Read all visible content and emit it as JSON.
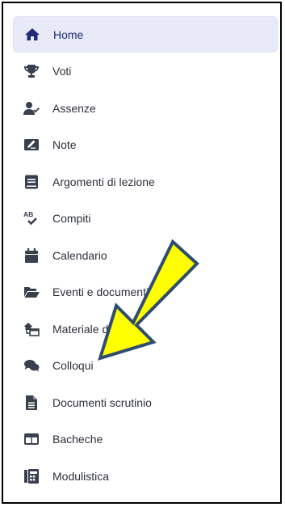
{
  "colors": {
    "accent": "#1f2a78",
    "icon": "#3a3f4d",
    "active_bg": "#e8ebf7",
    "arrow_fill": "#ffff00",
    "arrow_stroke": "#2f4d6e"
  },
  "menu": {
    "items": [
      {
        "label": "Home",
        "icon": "home-icon",
        "active": true
      },
      {
        "label": "Voti",
        "icon": "trophy-icon"
      },
      {
        "label": "Assenze",
        "icon": "user-check-icon"
      },
      {
        "label": "Note",
        "icon": "note-pen-icon"
      },
      {
        "label": "Argomenti di lezione",
        "icon": "book-icon"
      },
      {
        "label": "Compiti",
        "icon": "spellcheck-icon"
      },
      {
        "label": "Calendario",
        "icon": "calendar-icon"
      },
      {
        "label": "Eventi e documenti",
        "icon": "folder-open-icon"
      },
      {
        "label": "Materiale docente",
        "icon": "house-transfer-icon"
      },
      {
        "label": "Colloqui",
        "icon": "chat-bubbles-icon"
      },
      {
        "label": "Documenti scrutinio",
        "icon": "file-icon"
      },
      {
        "label": "Bacheche",
        "icon": "board-icon"
      },
      {
        "label": "Modulistica",
        "icon": "form-icon"
      }
    ]
  }
}
